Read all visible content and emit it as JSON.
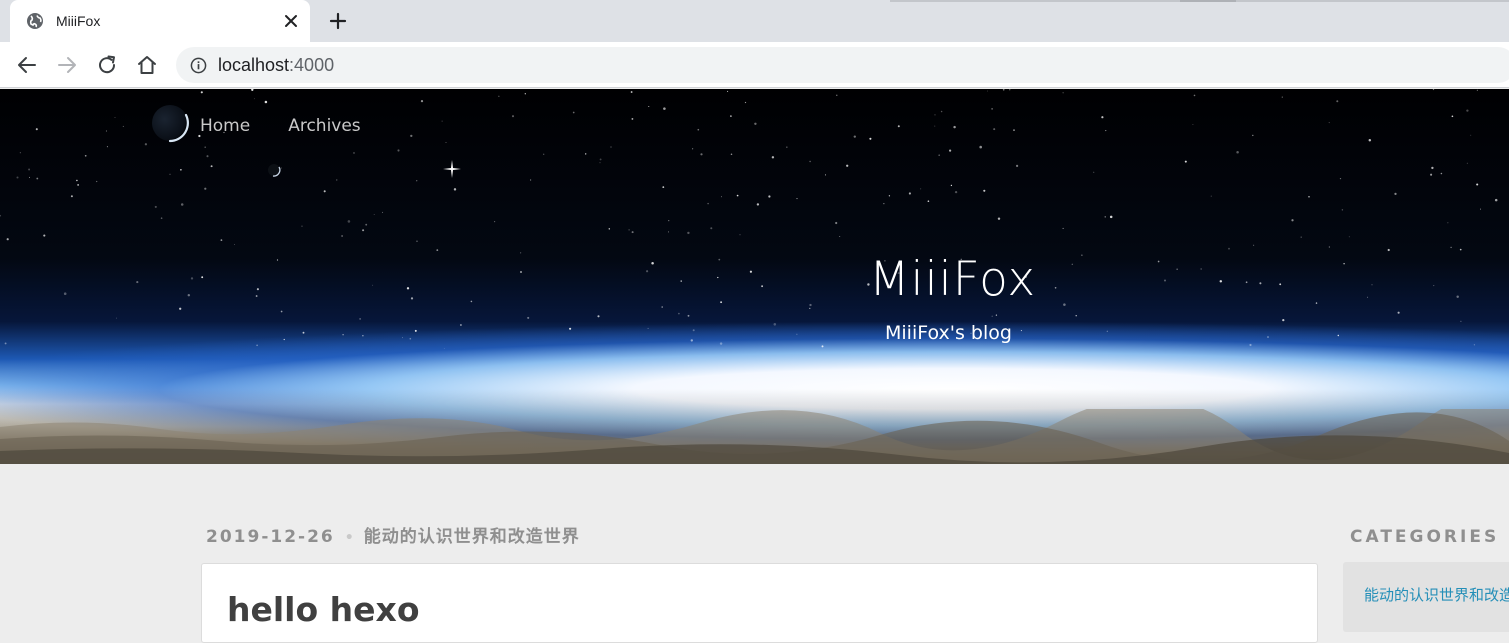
{
  "browser": {
    "tab_title": "MiiiFox",
    "url_host": "localhost",
    "url_port": ":4000",
    "icons": {
      "favicon": "globe-icon",
      "close": "close-icon",
      "new_tab": "plus-icon",
      "back": "arrow-left-icon",
      "forward": "arrow-right-icon",
      "reload": "reload-icon",
      "home": "home-icon",
      "site_info": "info-icon"
    }
  },
  "site": {
    "nav": [
      {
        "label": "Home"
      },
      {
        "label": "Archives"
      }
    ],
    "title": "MiiiFox",
    "subtitle": "MiiiFox's blog"
  },
  "post": {
    "date": "2019-12-26",
    "separator": "•",
    "category": "能动的认识世界和改造世界",
    "title": "hello hexo"
  },
  "sidebar": {
    "categories_title": "CATEGORIES",
    "categories": [
      {
        "label": "能动的认识世界和改造世界"
      }
    ]
  },
  "colors": {
    "tabstrip_bg": "#dee1e6",
    "page_bg": "#ededed",
    "meta_text": "#8f8f8f",
    "link": "#258fb8",
    "post_title": "#404040"
  }
}
